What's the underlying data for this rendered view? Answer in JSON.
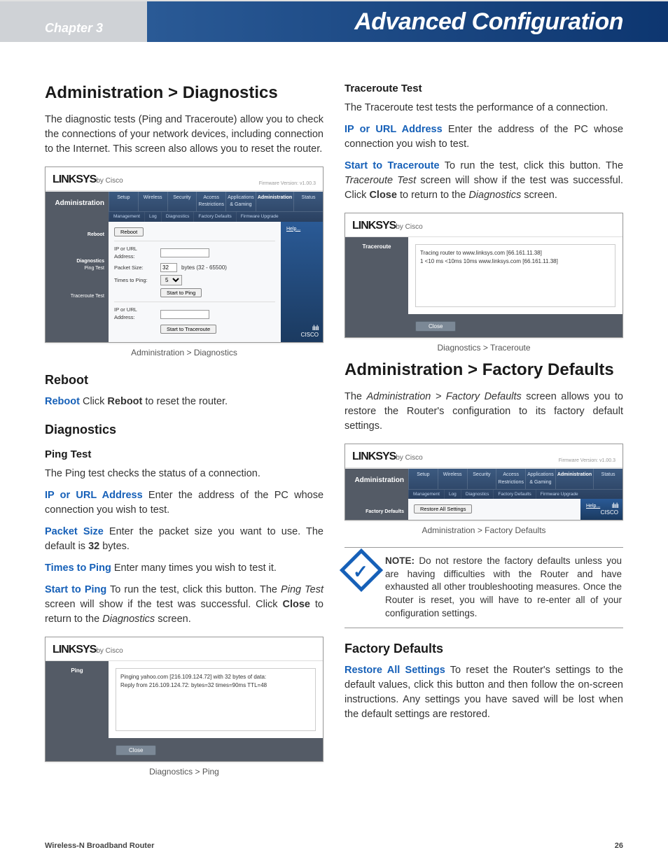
{
  "header": {
    "chapter": "Chapter 3",
    "title": "Advanced Configuration"
  },
  "left": {
    "h1": "Administration > Diagnostics",
    "intro": "The diagnostic tests (Ping and Traceroute) allow you to check the connections of your network devices, including connection to the Internet. This screen also allows you to reset the router.",
    "fig1": {
      "logo": "LINKSYS",
      "by": "by Cisco",
      "fw": "Firmware Version: v1.00.3",
      "admin": "Administration",
      "tabs": [
        "Setup",
        "Wireless",
        "Security",
        "Access Restrictions",
        "Applications & Gaming",
        "Administration",
        "Status"
      ],
      "subtabs": [
        "Management",
        "Log",
        "Diagnostics",
        "Factory Defaults",
        "Firmware Upgrade"
      ],
      "help": "Help...",
      "side": {
        "reboot": "Reboot",
        "diag": "Diagnostics",
        "pingtest": "Ping Test",
        "tracetest": "Traceroute Test"
      },
      "form": {
        "ipurl": "IP or URL Address:",
        "packet": "Packet Size:",
        "times": "Times to Ping:",
        "packet_val": "32",
        "packet_hint": "bytes (32 - 65500)",
        "times_val": "5",
        "reboot_btn": "Reboot",
        "startping": "Start to Ping",
        "starttrace": "Start to Traceroute",
        "ipurl2": "IP or URL Address:"
      },
      "cisco_bars": "ılıılı",
      "cisco": "CISCO",
      "caption": "Administration > Diagnostics"
    },
    "reboot_h": "Reboot",
    "reboot_term": "Reboot",
    "reboot_txt_1": "  Click ",
    "reboot_bold": "Reboot",
    "reboot_txt_2": " to reset the router.",
    "diag_h": "Diagnostics",
    "ping_h": "Ping Test",
    "ping_intro": "The Ping test checks the status of a connection.",
    "ipurl_term": "IP or URL Address",
    "ipurl_txt": "  Enter the address of the PC whose connection you wish to test.",
    "packet_term": "Packet Size",
    "packet_txt_1": "  Enter the packet size you want to use. The default is ",
    "packet_bold": "32",
    "packet_txt_2": " bytes.",
    "times_term": "Times to Ping",
    "times_txt": "  Enter many times you wish to test it.",
    "startping_term": "Start to Ping",
    "startping_txt_1": "  To run the test, click this button. The ",
    "startping_ital": "Ping Test",
    "startping_txt_2": " screen will show if the test was successful. Click ",
    "startping_bold": "Close",
    "startping_txt_3": " to return to the ",
    "startping_ital2": "Diagnostics",
    "startping_txt_4": " screen.",
    "fig2": {
      "side": "Ping",
      "line1": "Pinging yahoo.com [216.109.124.72] with 32 bytes of data:",
      "line2": "Reply from 216.109.124.72: bytes=32 times=90ms TTL=48",
      "close": "Close",
      "caption": "Diagnostics > Ping"
    }
  },
  "right": {
    "trace_h": "Traceroute Test",
    "trace_intro": "The Traceroute test tests the performance of a connection.",
    "ipurl_term": "IP or URL Address",
    "ipurl_txt": "  Enter the address of the PC whose connection you wish to test.",
    "starttrace_term": "Start to Traceroute",
    "starttrace_txt_1": "  To run the test, click this button. The ",
    "starttrace_ital": "Traceroute Test",
    "starttrace_txt_2": " screen will show if the test was successful. Click ",
    "starttrace_bold": "Close",
    "starttrace_txt_3": " to return to the ",
    "starttrace_ital2": "Diagnostics",
    "starttrace_txt_4": " screen.",
    "fig3": {
      "side": "Traceroute",
      "line1": "Tracing router to www.linksys.com [66.161.11.38]",
      "line2": "1  <10 ms  <10ms  10ms  www.linksys.com [66.161.11.38]",
      "close": "Close",
      "caption": "Diagnostics > Traceroute"
    },
    "fd_h1": "Administration > Factory Defaults",
    "fd_intro_1": "The ",
    "fd_intro_ital": "Administration > Factory Defaults",
    "fd_intro_2": " screen allows you to restore the Router's configuration to its factory default settings.",
    "fig4": {
      "admin": "Administration",
      "fw": "Firmware Version: v1.00.3",
      "tabs": [
        "Setup",
        "Wireless",
        "Security",
        "Access Restrictions",
        "Applications & Gaming",
        "Administration",
        "Status"
      ],
      "subtabs": [
        "Management",
        "Log",
        "Diagnostics",
        "Factory Defaults",
        "Firmware Upgrade"
      ],
      "side": "Factory Defaults",
      "btn": "Restore All Settings",
      "help": "Help...",
      "cisco_bars": "ılıılı",
      "cisco": "CISCO",
      "caption": "Administration > Factory Defaults"
    },
    "note_label": "NOTE:",
    "note_txt": " Do not restore the factory defaults unless you are having difficulties with the Router and have exhausted all other troubleshooting measures. Once the Router is reset, you will have to re-enter all of your configuration settings.",
    "fd_h2": "Factory Defaults",
    "restore_term": "Restore All Settings",
    "restore_txt": "  To reset the Router's settings to the default values, click this button and then follow the on-screen instructions. Any settings you have saved will be lost when the default settings are restored."
  },
  "footer": {
    "product": "Wireless-N Broadband Router",
    "page": "26"
  }
}
